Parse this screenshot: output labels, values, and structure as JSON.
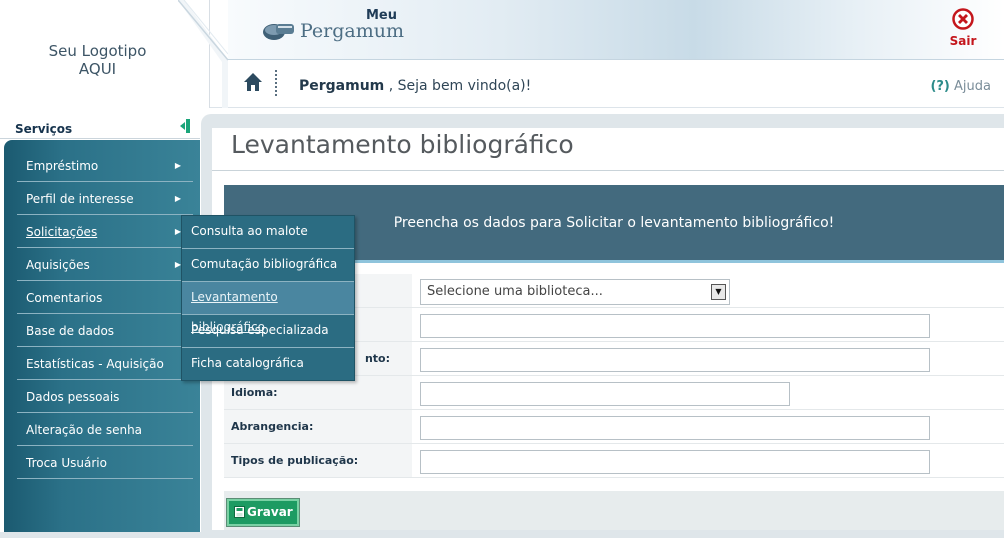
{
  "header": {
    "logo_text": "Seu Logotipo AQUI",
    "brand_small": "Meu",
    "brand_name": "Pergamum",
    "logout_label": "Sair",
    "welcome_name": "Pergamum",
    "welcome_text": " , Seja bem vindo(a)!",
    "help_mark": "(?)",
    "help_label": " Ajuda"
  },
  "sidebar": {
    "title": "Serviços",
    "items": [
      {
        "label": "Empréstimo",
        "arrow": "▶"
      },
      {
        "label": "Perfil de interesse",
        "arrow": "▶"
      },
      {
        "label": "Solicitações",
        "arrow": "▶"
      },
      {
        "label": "Aquisições",
        "arrow": "▶"
      },
      {
        "label": "Comentarios"
      },
      {
        "label": "Base de dados"
      },
      {
        "label": "Estatísticas - Aquisição"
      },
      {
        "label": "Dados pessoais"
      },
      {
        "label": "Alteração de senha"
      },
      {
        "label": "Troca Usuário"
      }
    ]
  },
  "submenu": {
    "items": [
      {
        "label": "Consulta ao malote"
      },
      {
        "label": "Comutação bibliográfica"
      },
      {
        "label": "Levantamento bibliográfico"
      },
      {
        "label": "Pesquisa especializada"
      },
      {
        "label": "Ficha catalográfica"
      }
    ]
  },
  "main": {
    "title": "Levantamento bibliográfico",
    "notice": "Preencha os dados para Solicitar o levantamento bibliográfico!",
    "form": {
      "library_label": "",
      "library_placeholder": "Selecione uma biblioteca...",
      "field2_label": "",
      "field3_label": "nto:",
      "idioma_label": "Idioma:",
      "abrangencia_label": "Abrangencia:",
      "tipos_label": "Tipos de publicação:"
    },
    "save_label": "Gravar"
  },
  "colors": {
    "menu_bg": "#2b7188",
    "notice_bg": "#436a7e",
    "save_green": "#1d9b62",
    "logout_red": "#c4161c"
  }
}
